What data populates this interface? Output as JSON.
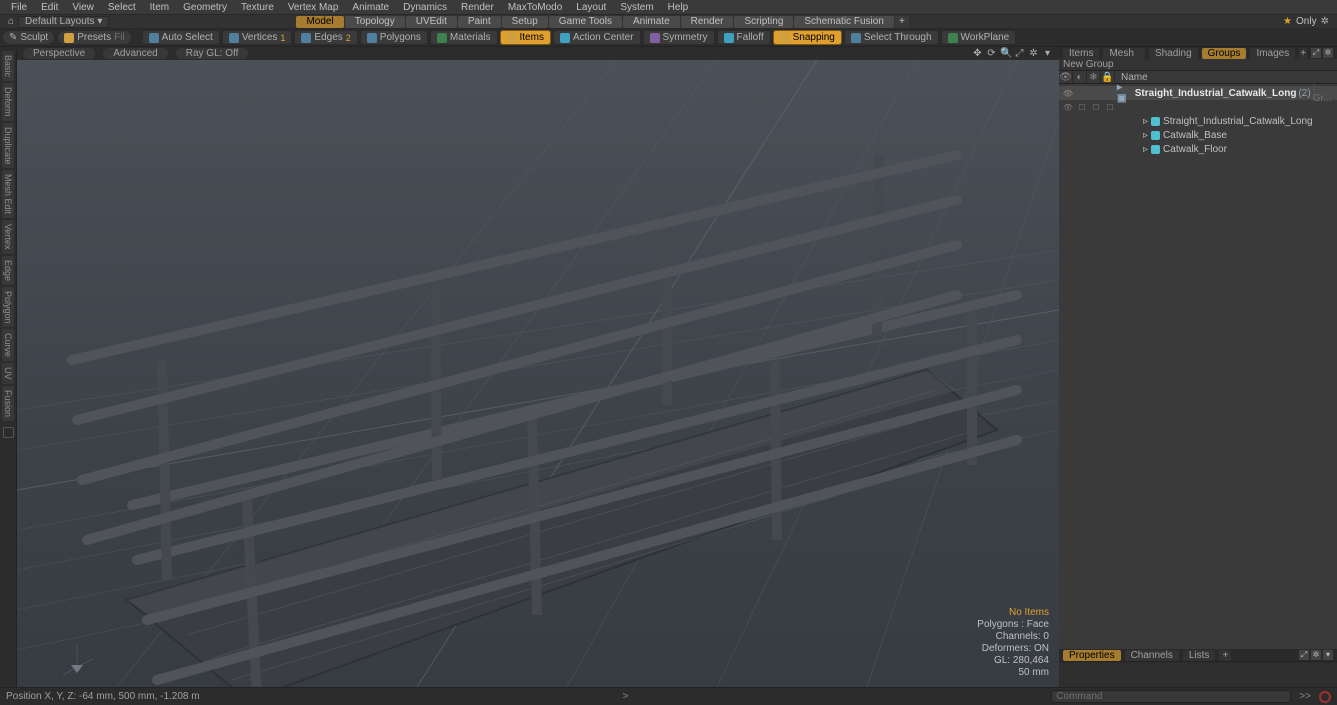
{
  "menu": [
    "File",
    "Edit",
    "View",
    "Select",
    "Item",
    "Geometry",
    "Texture",
    "Vertex Map",
    "Animate",
    "Dynamics",
    "Render",
    "MaxToModo",
    "Layout",
    "System",
    "Help"
  ],
  "layout_dropdown": "Default Layouts ▾",
  "mode_tabs": [
    "Model",
    "Topology",
    "UVEdit",
    "Paint",
    "Setup",
    "Game Tools",
    "Animate",
    "Render",
    "Scripting",
    "Schematic Fusion"
  ],
  "mode_active": 0,
  "only_label": "Only",
  "toolbar": {
    "sculpt": "Sculpt",
    "presets": "Presets",
    "fill": "Fil",
    "autoselect": "Auto Select",
    "vertices": "Vertices",
    "vertices_n": "1",
    "edges": "Edges",
    "edges_n": "2",
    "polygons": "Polygons",
    "polygons_n": "",
    "materials": "Materials",
    "items": "Items",
    "actioncenter": "Action Center",
    "symmetry": "Symmetry",
    "falloff": "Falloff",
    "snapping": "Snapping",
    "selthrough": "Select Through",
    "workplane": "WorkPlane"
  },
  "left_tabs": [
    "Basic",
    "Deform",
    "Duplicate",
    "Mesh Edit",
    "Vertex",
    "Edge",
    "Polygon",
    "Curve",
    "UV",
    "Fusion"
  ],
  "view": {
    "perspective": "Perspective",
    "advanced": "Advanced",
    "raygl": "Ray GL: Off"
  },
  "stats": {
    "noitems": "No Items",
    "polygons": "Polygons : Face",
    "channels": "Channels: 0",
    "deformers": "Deformers: ON",
    "gl": "GL: 280,464",
    "mm": "50 mm"
  },
  "right": {
    "tabs": [
      "Items",
      "Mesh Ops",
      "Shading",
      "Groups",
      "Images"
    ],
    "tabs_active": 3,
    "newgroup": "New Group",
    "name_hdr": "Name",
    "group_name": "Straight_Industrial_Catwalk_Long",
    "group_count": "(2)",
    "group_suffix": ": Gr...",
    "children": [
      "Straight_Industrial_Catwalk_Long",
      "Catwalk_Base",
      "Catwalk_Floor"
    ],
    "prop_tabs": [
      "Properties",
      "Channels",
      "Lists"
    ]
  },
  "status": {
    "pos": "Position X, Y, Z:   -64 mm,  500 mm,  -1.208 m",
    "cmd_ph": "Command",
    "hist": ">>"
  }
}
